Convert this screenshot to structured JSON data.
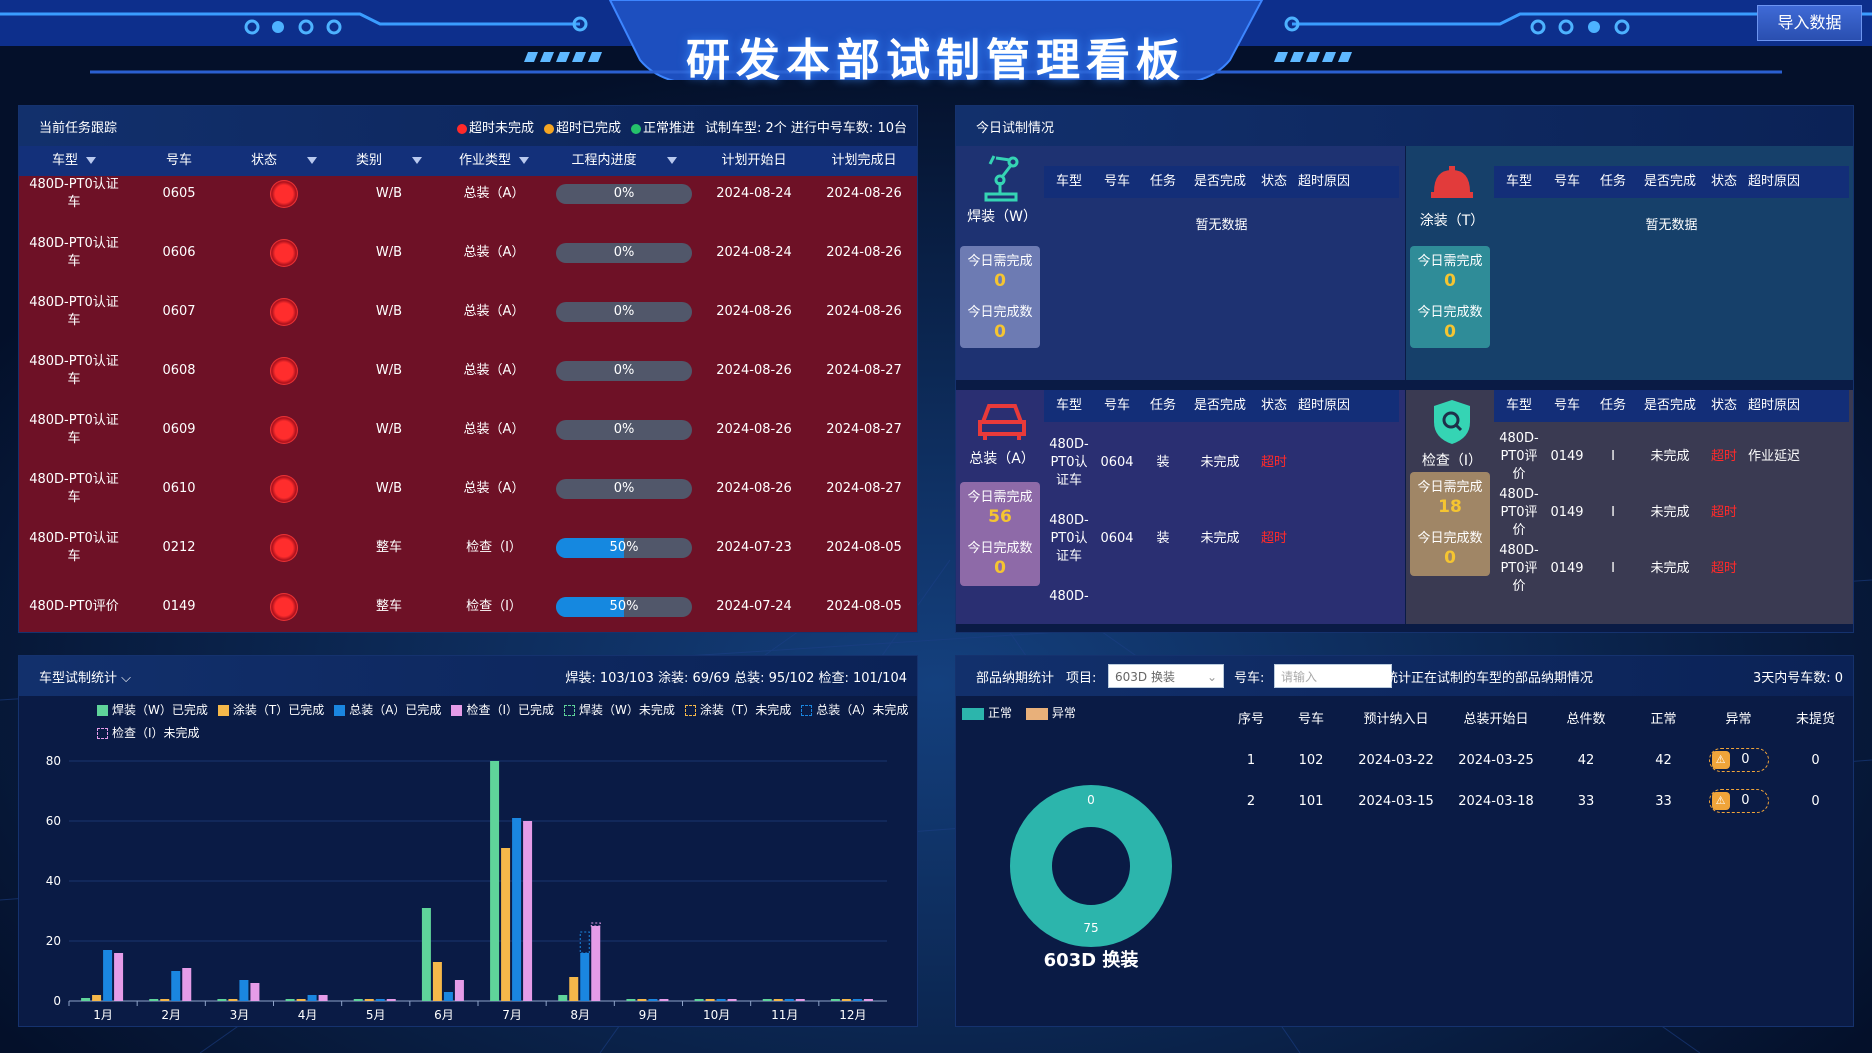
{
  "header": {
    "title": "研发本部试制管理看板",
    "import_label": "导入数据"
  },
  "tasks": {
    "title": "当前任务跟踪",
    "legend": [
      {
        "label": "超时未完成",
        "color": "#ff2a2a"
      },
      {
        "label": "超时已完成",
        "color": "#f5a623"
      },
      {
        "label": "正常推进",
        "color": "#25c26b"
      }
    ],
    "summary": "试制车型: 2个  进行中号车数: 10台",
    "columns": [
      "车型",
      "号车",
      "状态",
      "类别",
      "作业类型",
      "工程内进度",
      "计划开始日",
      "计划完成日"
    ],
    "rows": [
      {
        "model": "480D-PT0认证车",
        "car": "0605",
        "category": "W/B",
        "op": "总装（A）",
        "progress": 0,
        "progress_label": "0%",
        "start": "2024-08-24",
        "end": "2024-08-26"
      },
      {
        "model": "480D-PT0认证车",
        "car": "0606",
        "category": "W/B",
        "op": "总装（A）",
        "progress": 0,
        "progress_label": "0%",
        "start": "2024-08-24",
        "end": "2024-08-26"
      },
      {
        "model": "480D-PT0认证车",
        "car": "0607",
        "category": "W/B",
        "op": "总装（A）",
        "progress": 0,
        "progress_label": "0%",
        "start": "2024-08-26",
        "end": "2024-08-26"
      },
      {
        "model": "480D-PT0认证车",
        "car": "0608",
        "category": "W/B",
        "op": "总装（A）",
        "progress": 0,
        "progress_label": "0%",
        "start": "2024-08-26",
        "end": "2024-08-27"
      },
      {
        "model": "480D-PT0认证车",
        "car": "0609",
        "category": "W/B",
        "op": "总装（A）",
        "progress": 0,
        "progress_label": "0%",
        "start": "2024-08-26",
        "end": "2024-08-27"
      },
      {
        "model": "480D-PT0认证车",
        "car": "0610",
        "category": "W/B",
        "op": "总装（A）",
        "progress": 0,
        "progress_label": "0%",
        "start": "2024-08-26",
        "end": "2024-08-27"
      },
      {
        "model": "480D-PT0认证车",
        "car": "0212",
        "category": "整车",
        "op": "检查（I）",
        "progress": 50,
        "progress_label": "50%",
        "start": "2024-07-23",
        "end": "2024-08-05"
      },
      {
        "model": "480D-PT0评价",
        "car": "0149",
        "category": "整车",
        "op": "检查（I）",
        "progress": 50,
        "progress_label": "50%",
        "start": "2024-07-24",
        "end": "2024-08-05"
      }
    ]
  },
  "today": {
    "title": "今日试制情况",
    "columns": [
      "车型",
      "号车",
      "任务",
      "是否完成",
      "状态",
      "超时原因"
    ],
    "need_label": "今日需完成",
    "done_label": "今日完成数",
    "empty_label": "暂无数据",
    "weld": {
      "name": "焊装（W）",
      "need": "0",
      "done": "0",
      "icon": "robot-arm-icon"
    },
    "paint": {
      "name": "涂装（T）",
      "need": "0",
      "done": "0",
      "icon": "helmet-icon"
    },
    "assembly": {
      "name": "总装（A）",
      "need": "56",
      "done": "0",
      "icon": "car-icon",
      "rows": [
        {
          "model": "480D-PT0认证车",
          "car": "0604",
          "task": "装",
          "done": "未完成",
          "status": "超时",
          "reason": ""
        },
        {
          "model": "480D-PT0认证车",
          "car": "0604",
          "task": "装",
          "done": "未完成",
          "status": "超时",
          "reason": ""
        },
        {
          "model": "480D-",
          "car": "",
          "task": "",
          "done": "",
          "status": "",
          "reason": ""
        }
      ]
    },
    "inspect": {
      "name": "检查（I）",
      "need": "18",
      "done": "0",
      "icon": "shield-search-icon",
      "rows": [
        {
          "model": "480D-PT0评价",
          "car": "0149",
          "task": "I",
          "done": "未完成",
          "status": "超时",
          "reason": "作业延迟"
        },
        {
          "model": "480D-PT0评价",
          "car": "0149",
          "task": "I",
          "done": "未完成",
          "status": "超时",
          "reason": ""
        },
        {
          "model": "480D-PT0评价",
          "car": "0149",
          "task": "I",
          "done": "未完成",
          "status": "超时",
          "reason": ""
        }
      ]
    }
  },
  "stats": {
    "title": "车型试制统计",
    "summary": "焊装: 103/103  涂装: 69/69  总装: 95/102  检查: 101/104"
  },
  "chart_data": {
    "type": "bar",
    "categories": [
      "1月",
      "2月",
      "3月",
      "4月",
      "5月",
      "6月",
      "7月",
      "8月",
      "9月",
      "10月",
      "11月",
      "12月"
    ],
    "ylim": [
      0,
      80
    ],
    "yticks": [
      0,
      20,
      40,
      60,
      80
    ],
    "series": [
      {
        "name": "焊装（W）已完成",
        "color": "#5fd49a",
        "values": [
          1,
          0,
          0,
          0,
          0,
          31,
          80,
          2,
          0,
          0,
          0,
          0
        ]
      },
      {
        "name": "涂装（T）已完成",
        "color": "#f5b84a",
        "values": [
          2,
          0,
          0,
          0,
          0,
          13,
          51,
          8,
          0,
          0,
          0,
          0
        ]
      },
      {
        "name": "总装（A）已完成",
        "color": "#1a86e0",
        "values": [
          17,
          10,
          7,
          2,
          0,
          3,
          61,
          16,
          0,
          0,
          0,
          0
        ]
      },
      {
        "name": "检查（I）已完成",
        "color": "#e59ce8",
        "values": [
          16,
          11,
          6,
          2,
          0,
          7,
          60,
          25,
          0,
          0,
          0,
          0
        ]
      },
      {
        "name": "焊装（W）未完成",
        "color": "#5fd49a",
        "dashed": true,
        "values": [
          0,
          0,
          0,
          0,
          0,
          0,
          0,
          0,
          0,
          0,
          0,
          0
        ]
      },
      {
        "name": "涂装（T）未完成",
        "color": "#f5b84a",
        "dashed": true,
        "values": [
          0,
          0,
          0,
          0,
          0,
          0,
          0,
          0,
          0,
          0,
          0,
          0
        ]
      },
      {
        "name": "总装（A）未完成",
        "color": "#1a86e0",
        "dashed": true,
        "values": [
          0,
          0,
          0,
          0,
          0,
          0,
          0,
          7,
          0,
          0,
          0,
          0
        ]
      },
      {
        "name": "检查（I）未完成",
        "color": "#e59ce8",
        "dashed": true,
        "values": [
          0,
          0,
          0,
          0,
          0,
          0,
          0,
          1,
          0,
          0,
          0,
          0
        ]
      }
    ]
  },
  "parts": {
    "title": "部品纳期统计",
    "project_label": "项目:",
    "project_value": "603D 换装",
    "car_label": "号车:",
    "car_placeholder": "请输入",
    "note": "*仅统计正在试制的车型的部品纳期情况",
    "three_day": "3天内号车数: 0",
    "legend_normal": "正常",
    "legend_abnormal": "异常",
    "donut": {
      "normal": 75,
      "abnormal": 0,
      "normal_label": "75",
      "abnormal_label": "0",
      "caption": "603D 换装",
      "normal_color": "#2cb5ac",
      "abnormal_color": "#e8b07a"
    },
    "columns": [
      "序号",
      "号车",
      "预计纳入日",
      "总装开始日",
      "总件数",
      "正常",
      "异常",
      "未提货"
    ],
    "rows": [
      {
        "no": "1",
        "car": "102",
        "eta": "2024-03-22",
        "start": "2024-03-25",
        "total": "42",
        "normal": "42",
        "abnormal": "0",
        "pending": "0"
      },
      {
        "no": "2",
        "car": "101",
        "eta": "2024-03-15",
        "start": "2024-03-18",
        "total": "33",
        "normal": "33",
        "abnormal": "0",
        "pending": "0"
      }
    ]
  }
}
